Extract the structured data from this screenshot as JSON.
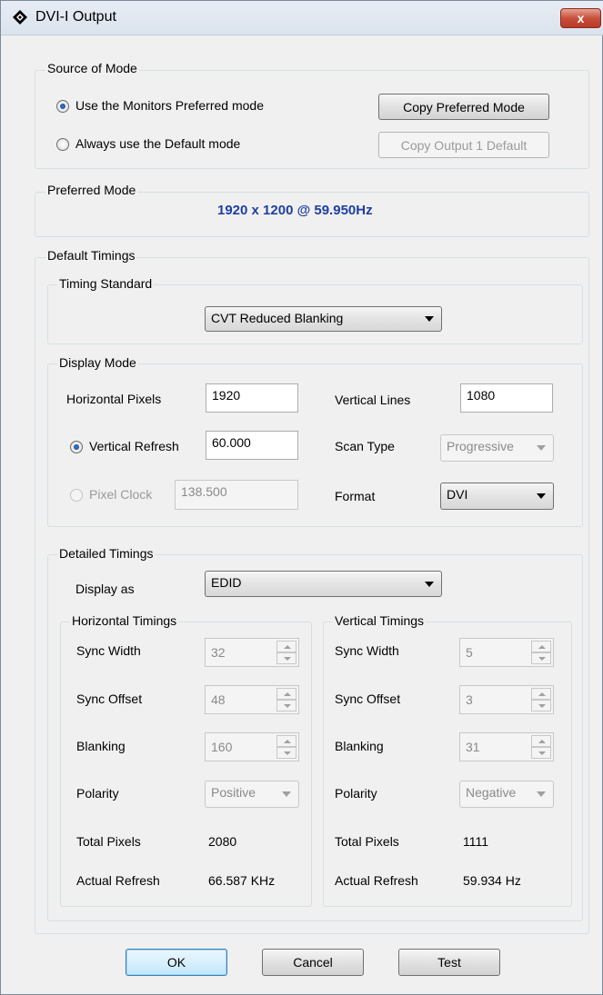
{
  "window": {
    "title": "DVI-I Output",
    "close_label": "x"
  },
  "source_of_mode": {
    "legend": "Source of Mode",
    "option_preferred": "Use the Monitors Preferred mode",
    "option_default": "Always use the Default mode",
    "copy_preferred_button": "Copy Preferred Mode",
    "copy_default_button": "Copy Output 1 Default",
    "selected": "preferred"
  },
  "preferred_mode": {
    "legend": "Preferred Mode",
    "value": "1920 x 1200 @ 59.950Hz"
  },
  "default_timings": {
    "legend": "Default Timings",
    "timing_standard": {
      "legend": "Timing Standard",
      "selected": "CVT Reduced Blanking"
    },
    "display_mode": {
      "legend": "Display Mode",
      "horizontal_pixels_label": "Horizontal Pixels",
      "horizontal_pixels": "1920",
      "vertical_lines_label": "Vertical Lines",
      "vertical_lines": "1080",
      "vertical_refresh_label": "Vertical Refresh",
      "vertical_refresh": "60.000",
      "scan_type_label": "Scan Type",
      "scan_type": "Progressive",
      "pixel_clock_label": "Pixel Clock",
      "pixel_clock": "138.500",
      "format_label": "Format",
      "format": "DVI"
    },
    "detailed_timings": {
      "legend": "Detailed Timings",
      "display_as_label": "Display as",
      "display_as": "EDID",
      "horizontal": {
        "legend": "Horizontal Timings",
        "sync_width_label": "Sync Width",
        "sync_width": "32",
        "sync_offset_label": "Sync Offset",
        "sync_offset": "48",
        "blanking_label": "Blanking",
        "blanking": "160",
        "polarity_label": "Polarity",
        "polarity": "Positive",
        "total_label": "Total Pixels",
        "total": "2080",
        "actual_refresh_label": "Actual Refresh",
        "actual_refresh": "66.587 KHz"
      },
      "vertical": {
        "legend": "Vertical Timings",
        "sync_width_label": "Sync Width",
        "sync_width": "5",
        "sync_offset_label": "Sync Offset",
        "sync_offset": "3",
        "blanking_label": "Blanking",
        "blanking": "31",
        "polarity_label": "Polarity",
        "polarity": "Negative",
        "total_label": "Total Pixels",
        "total": "1111",
        "actual_refresh_label": "Actual Refresh",
        "actual_refresh": "59.934 Hz"
      }
    }
  },
  "buttons": {
    "ok": "OK",
    "cancel": "Cancel",
    "test": "Test"
  },
  "icons": {
    "title_icon": "diamond-app-icon",
    "close_icon": "close-icon"
  }
}
